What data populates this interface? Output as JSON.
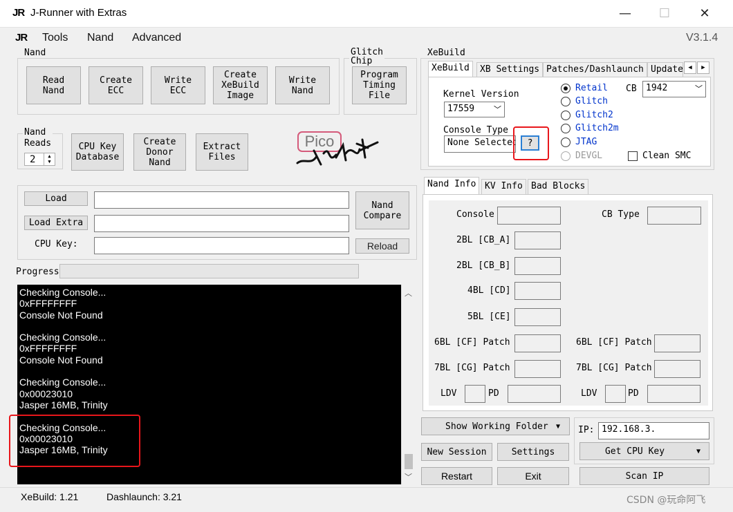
{
  "window": {
    "title": "J-Runner with Extras",
    "logo": "JR",
    "minimize": "—",
    "maximize": "☐",
    "close": "✕"
  },
  "menu": {
    "logo": "JR",
    "items": [
      "Tools",
      "Nand",
      "Advanced"
    ],
    "version": "V3.1.4"
  },
  "nand_group": {
    "label": "Nand",
    "buttons": [
      "Read\nNand",
      "Create\nECC",
      "Write\nECC",
      "Create\nXeBuild\nImage",
      "Write\nNand"
    ]
  },
  "glitch_group": {
    "label": "Glitch\nChip",
    "button": "Program\nTiming\nFile"
  },
  "nand_reads": {
    "label": "Nand\nReads",
    "value": "2"
  },
  "tools_buttons": [
    "CPU Key\nDatabase",
    "Create\nDonor\nNand",
    "Extract\nFiles"
  ],
  "pico_logo": {
    "text": "Pico",
    "signature": "FLASHER"
  },
  "files": {
    "load": "Load",
    "load_extra": "Load Extra",
    "cpu_key_label": "CPU Key:",
    "load_value": "",
    "load_extra_value": "",
    "cpu_key_value": "",
    "nand_compare": "Nand\nCompare",
    "reload": "Reload"
  },
  "progress": {
    "label": "Progress",
    "value": 0
  },
  "console": {
    "lines": [
      "Checking Console...",
      "0xFFFFFFFF",
      "Console Not Found",
      "",
      "Checking Console...",
      "0xFFFFFFFF",
      "Console Not Found",
      "",
      "Checking Console...",
      "0x00023010",
      "Jasper 16MB, Trinity",
      "",
      "Checking Console...",
      "0x00023010",
      "Jasper 16MB, Trinity"
    ]
  },
  "xebuild": {
    "group_label": "XeBuild",
    "tabs": [
      "XeBuild",
      "XB Settings",
      "Patches/Dashlaunch",
      "Update"
    ],
    "kernel_label": "Kernel Version",
    "kernel_value": "17559",
    "console_type_label": "Console Type",
    "console_type_value": "None Selected",
    "help_button": "?",
    "radios": [
      "Retail",
      "Glitch",
      "Glitch2",
      "Glitch2m",
      "JTAG",
      "DEVGL"
    ],
    "selected_radio": "Retail",
    "cb_label": "CB",
    "cb_value": "1942",
    "clean_smc": "Clean SMC"
  },
  "info_tabs": [
    "Nand Info",
    "KV Info",
    "Bad Blocks"
  ],
  "nand_info": {
    "console": "Console",
    "cb_type": "CB Type",
    "bl2": "2BL [CB_A]",
    "bl2b": "2BL [CB_B]",
    "bl4": "4BL [CD]",
    "bl5": "5BL [CE]",
    "bl6_0": "6BL [CF] Patch 0",
    "bl6_1": "6BL [CF] Patch 1",
    "bl7_0": "7BL [CG] Patch 0",
    "bl7_1": "7BL [CG] Patch 1",
    "ldv": "LDV",
    "pd": "PD"
  },
  "bottom": {
    "show_folder": "Show Working Folder",
    "ip_label": "IP:",
    "ip_value": "192.168.3.",
    "new_session": "New Session",
    "settings": "Settings",
    "get_cpu_key": "Get CPU Key",
    "restart": "Restart",
    "exit": "Exit",
    "scan_ip": "Scan IP"
  },
  "status": {
    "xebuild": "XeBuild:  1.21",
    "dashlaunch": "Dashlaunch:  3.21"
  },
  "watermark": "CSDN @玩命阿飞",
  "colors": {
    "highlight": "#e8161b",
    "radio_text": "#0033cc",
    "console_bg": "#000000"
  }
}
